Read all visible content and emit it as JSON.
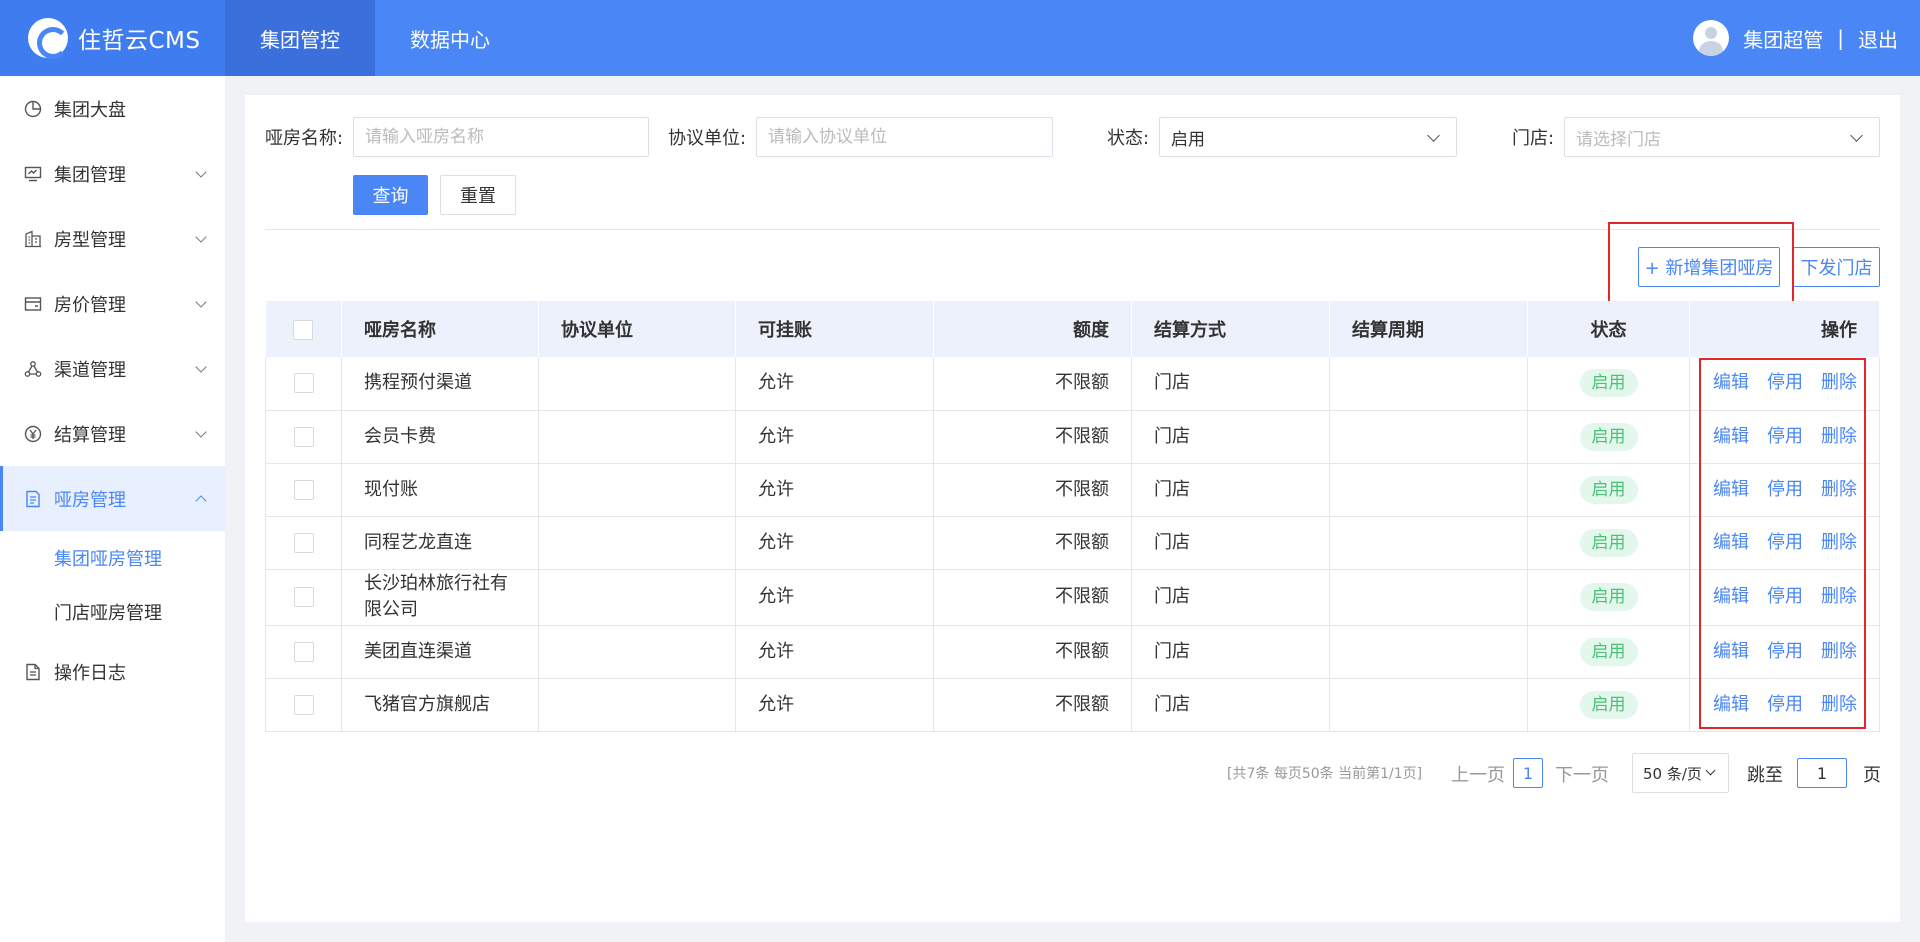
{
  "header": {
    "logo_text": "住哲云CMS",
    "tabs": [
      {
        "label": "集团管控",
        "active": true
      },
      {
        "label": "数据中心",
        "active": false
      }
    ],
    "user_name": "集团超管",
    "separator": "|",
    "logout_label": "退出"
  },
  "sidebar": {
    "items": [
      {
        "label": "集团大盘",
        "icon": "pie-chart-icon"
      },
      {
        "label": "集团管理",
        "icon": "monitor-icon"
      },
      {
        "label": "房型管理",
        "icon": "building-icon"
      },
      {
        "label": "房价管理",
        "icon": "wallet-icon"
      },
      {
        "label": "渠道管理",
        "icon": "share-nodes-icon"
      },
      {
        "label": "结算管理",
        "icon": "yen-icon"
      },
      {
        "label": "哑房管理",
        "icon": "document-icon"
      },
      {
        "label": "操作日志",
        "icon": "file-log-icon"
      }
    ],
    "subitems": [
      {
        "label": "集团哑房管理",
        "active": true
      },
      {
        "label": "门店哑房管理",
        "active": false
      }
    ]
  },
  "filters": {
    "room_name_label": "哑房名称:",
    "room_name_placeholder": "请输入哑房名称",
    "room_name_value": "",
    "agreement_label": "协议单位:",
    "agreement_placeholder": "请输入协议单位",
    "agreement_value": "",
    "status_label": "状态:",
    "status_value": "启用",
    "store_label": "门店:",
    "store_placeholder": "请选择门店",
    "query_label": "查询",
    "reset_label": "重置"
  },
  "actions": {
    "add_label": "+ 新增集团哑房",
    "dispatch_label": "下发门店"
  },
  "table": {
    "columns": [
      "哑房名称",
      "协议单位",
      "可挂账",
      "额度",
      "结算方式",
      "结算周期",
      "状态",
      "操作"
    ],
    "op_labels": {
      "edit": "编辑",
      "disable": "停用",
      "delete": "删除"
    },
    "rows": [
      {
        "name": "携程预付渠道",
        "agreement": "",
        "credit": "允许",
        "limit": "不限额",
        "settle": "门店",
        "cycle": "",
        "status": "启用"
      },
      {
        "name": "会员卡费",
        "agreement": "",
        "credit": "允许",
        "limit": "不限额",
        "settle": "门店",
        "cycle": "",
        "status": "启用"
      },
      {
        "name": "现付账",
        "agreement": "",
        "credit": "允许",
        "limit": "不限额",
        "settle": "门店",
        "cycle": "",
        "status": "启用"
      },
      {
        "name": "同程艺龙直连",
        "agreement": "",
        "credit": "允许",
        "limit": "不限额",
        "settle": "门店",
        "cycle": "",
        "status": "启用"
      },
      {
        "name": "长沙珀林旅行社有限公司",
        "agreement": "",
        "credit": "允许",
        "limit": "不限额",
        "settle": "门店",
        "cycle": "",
        "status": "启用"
      },
      {
        "name": "美团直连渠道",
        "agreement": "",
        "credit": "允许",
        "limit": "不限额",
        "settle": "门店",
        "cycle": "",
        "status": "启用"
      },
      {
        "name": "飞猪官方旗舰店",
        "agreement": "",
        "credit": "允许",
        "limit": "不限额",
        "settle": "门店",
        "cycle": "",
        "status": "启用"
      }
    ]
  },
  "pagination": {
    "info": "[共7条 每页50条 当前第1/1页]",
    "prev_label": "上一页",
    "current_page": "1",
    "next_label": "下一页",
    "page_size": "50 条/页",
    "jump_label": "跳至",
    "jump_value": "1",
    "page_suffix": "页"
  },
  "colors": {
    "primary": "#4a86f5",
    "status_green": "#4cc17a",
    "highlight_red": "#e4262b"
  }
}
